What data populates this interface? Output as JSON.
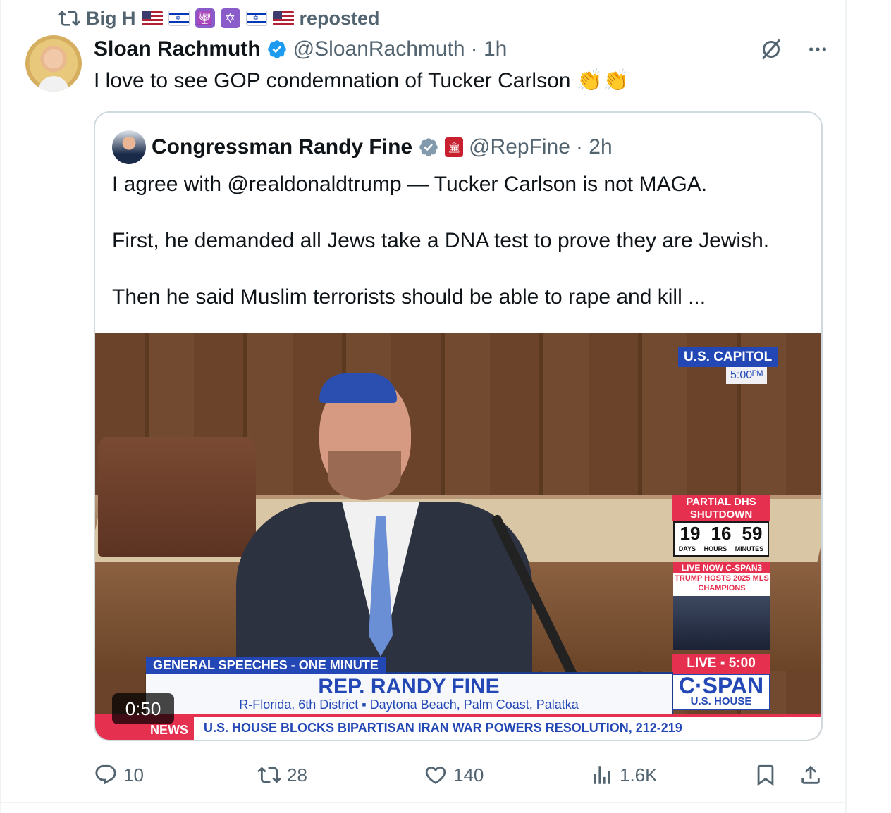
{
  "repost": {
    "user": "Big H",
    "label": "reposted",
    "emojis": [
      "us-flag",
      "israel-flag",
      "menorah",
      "star-of-david",
      "israel-flag",
      "us-flag"
    ]
  },
  "tweet": {
    "display_name": "Sloan Rachmuth",
    "handle": "@SloanRachmuth",
    "time": "· 1h",
    "text": "I love to see GOP condemnation of Tucker Carlson 👏👏"
  },
  "quote": {
    "display_name": "Congressman Randy Fine",
    "handle": "@RepFine",
    "time": "· 2h",
    "paragraphs": [
      "I agree with @realdonaldtrump — Tucker Carlson is not MAGA.",
      "First, he demanded all Jews take a DNA test to prove they are Jewish.",
      "Then he said Muslim terrorists should be able to rape and kill ..."
    ],
    "video": {
      "duration": "0:50",
      "location": "U.S. CAPITOL",
      "clock": "5:00ᴾᴹ",
      "segment": "GENERAL SPEECHES - ONE MINUTE",
      "speaker": "REP. RANDY FINE",
      "speaker_sub": "R-Florida, 6th District  ▪  Daytona Beach, Palm Coast, Palatka",
      "ticker_tag": "NEWS",
      "ticker": "U.S. HOUSE BLOCKS BIPARTISAN IRAN WAR POWERS RESOLUTION, 212-219",
      "dhs_label": "PARTIAL DHS SHUTDOWN",
      "dhs_days": "19",
      "dhs_hours": "16",
      "dhs_minutes": "59",
      "dhs_days_label": "DAYS",
      "dhs_hours_label": "HOURS",
      "dhs_minutes_label": "MINUTES",
      "live_now": "LIVE NOW C-SPAN3",
      "live_now_sub": "TRUMP HOSTS 2025 MLS CHAMPIONS",
      "live_bar": "LIVE ▪ 5:00",
      "network": "C·SPAN",
      "network_sub": "U.S. HOUSE"
    }
  },
  "actions": {
    "replies": "10",
    "reposts": "28",
    "likes": "140",
    "views": "1.6K"
  },
  "colors": {
    "accent": "#1d9bf0",
    "muted": "#536471",
    "cspan_blue": "#2348b6",
    "cspan_red": "#e6304f"
  }
}
